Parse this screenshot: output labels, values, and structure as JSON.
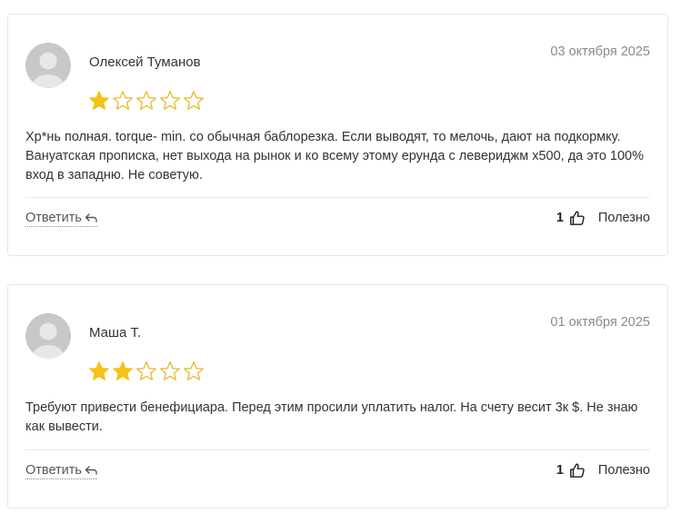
{
  "colors": {
    "star_filled": "#F3C318",
    "star_outline": "#E8B82A",
    "avatar_bg": "#C8C8C8",
    "avatar_fg": "#E7E7E7"
  },
  "reviews": [
    {
      "author": "Олексей Туманов",
      "date": "03 октября 2025",
      "rating": 1,
      "text": "Хр*нь полная. torque- min. со обычная баблорезка. Если выводят, то мелочь, дают на подкормку. Вануатская прописка, нет выхода на рынок и ко всему этому ерунда с левериджм х500, да это 100% вход в западню. Не советую.",
      "reply_label": "Ответить",
      "useful_count": "1",
      "useful_label": "Полезно"
    },
    {
      "author": "Маша Т.",
      "date": "01 октября 2025",
      "rating": 2,
      "text": "Требуют привести бенефициара. Перед этим просили уплатить налог. На счету весит 3к $. Не знаю как вывести.",
      "reply_label": "Ответить",
      "useful_count": "1",
      "useful_label": "Полезно"
    }
  ]
}
